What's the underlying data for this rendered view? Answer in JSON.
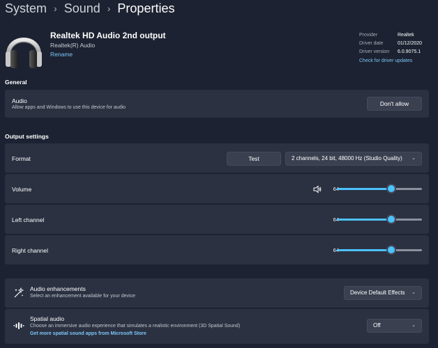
{
  "breadcrumb": {
    "items": [
      "System",
      "Sound"
    ],
    "current": "Properties",
    "separator": "›"
  },
  "device": {
    "name": "Realtek HD Audio 2nd output",
    "manufacturer": "Realtek(R) Audio",
    "rename_link": "Rename",
    "icon": "headphones-icon"
  },
  "driver": {
    "provider_label": "Provider",
    "provider_value": "Realtek",
    "date_label": "Driver date",
    "date_value": "01/12/2020",
    "version_label": "Driver version",
    "version_value": "6.0.9075.1",
    "update_link": "Check for driver updates"
  },
  "general": {
    "title": "General",
    "audio_label": "Audio",
    "audio_desc": "Allow apps and Windows to use this device for audio",
    "dont_allow_button": "Don't allow"
  },
  "output": {
    "title": "Output settings",
    "format_label": "Format",
    "test_button": "Test",
    "format_value": "2 channels, 24 bit, 48000 Hz (Studio Quality)",
    "volume_label": "Volume",
    "volume_value": "64",
    "left_label": "Left channel",
    "left_value": "64",
    "right_label": "Right channel",
    "right_value": "64",
    "volume_level": 64,
    "left_level": 64,
    "right_level": 64
  },
  "enhancements": {
    "label": "Audio enhancements",
    "desc": "Select an enhancement available for your device",
    "value": "Device Default Effects"
  },
  "spatial": {
    "label": "Spatial audio",
    "desc": "Choose an immersive audio experience that simulates a realistic environment (3D Spatial Sound)",
    "link": "Get more spatial sound apps from Microsoft Store",
    "value": "Off"
  },
  "colors": {
    "background": "#1c2231",
    "card": "#2b3141",
    "accent": "#4cc2ff",
    "link": "#7cc6f7"
  }
}
